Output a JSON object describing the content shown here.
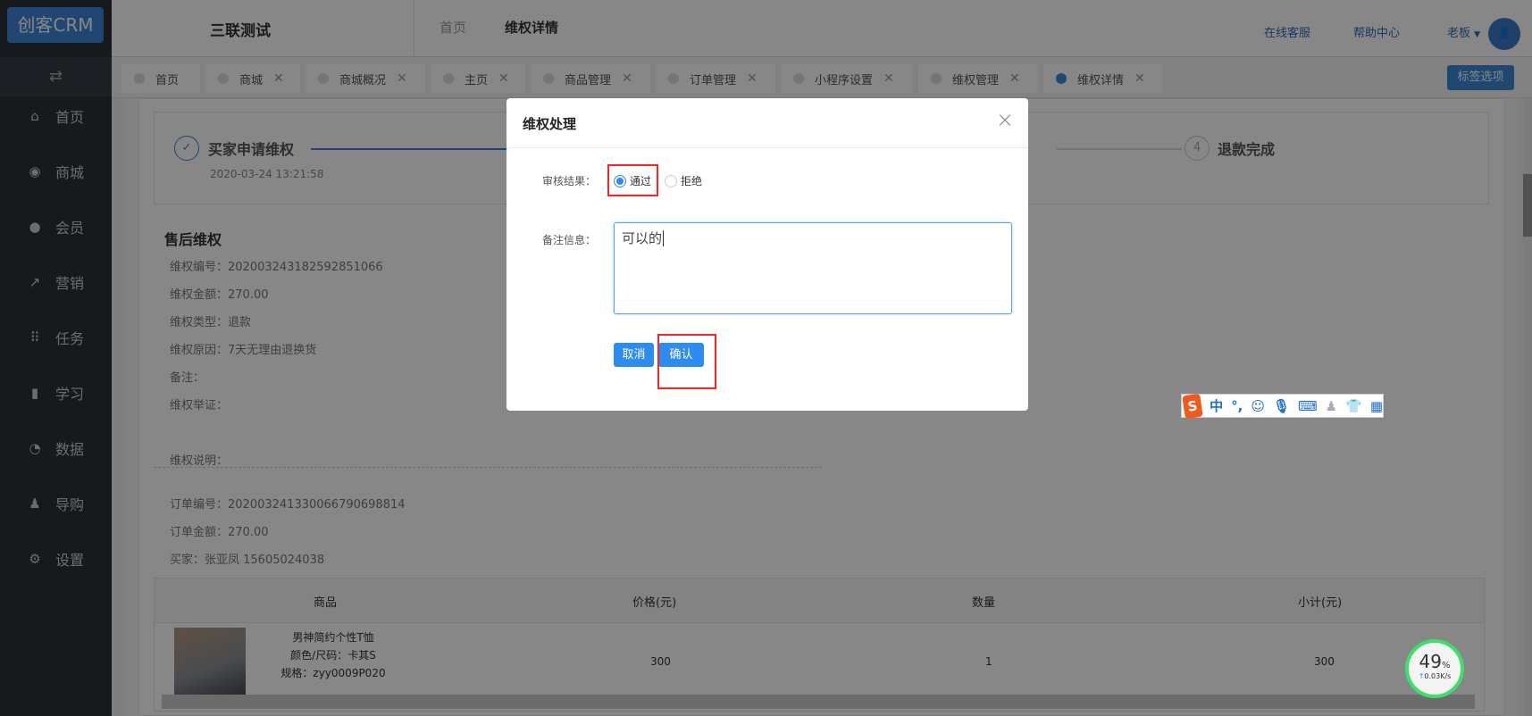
{
  "app": {
    "logo": "创客CRM",
    "company": "三联测试",
    "breadcrumb": [
      "首页",
      "维权详情"
    ],
    "links": [
      "在线客服",
      "帮助中心"
    ],
    "user": "老板"
  },
  "sidebar": [
    {
      "icon": "home-icon",
      "g": "⌂",
      "label": "首页"
    },
    {
      "icon": "shop-icon",
      "g": "◉",
      "label": "商城"
    },
    {
      "icon": "member-icon",
      "g": "●",
      "label": "会员"
    },
    {
      "icon": "marketing-icon",
      "g": "↗",
      "label": "营销"
    },
    {
      "icon": "task-icon",
      "g": "⠿",
      "label": "任务"
    },
    {
      "icon": "book-icon",
      "g": "▮",
      "label": "学习"
    },
    {
      "icon": "chart-icon",
      "g": "◔",
      "label": "数据"
    },
    {
      "icon": "guide-icon",
      "g": "♟",
      "label": "导购"
    },
    {
      "icon": "gear-icon",
      "g": "⚙",
      "label": "设置"
    }
  ],
  "tabs": [
    {
      "label": "首页",
      "close": false
    },
    {
      "label": "商城",
      "close": true
    },
    {
      "label": "商城概况",
      "close": true
    },
    {
      "label": "主页",
      "close": true
    },
    {
      "label": "商品管理",
      "close": true
    },
    {
      "label": "订单管理",
      "close": true
    },
    {
      "label": "小程序设置",
      "close": true
    },
    {
      "label": "维权管理",
      "close": true
    },
    {
      "label": "维权详情",
      "close": true,
      "active": true
    }
  ],
  "tab_options": "标签选项",
  "steps": {
    "first": {
      "label": "买家申请维权",
      "time": "2020-03-24 13:21:58"
    },
    "last": {
      "num": "4",
      "label": "退款完成"
    }
  },
  "detail": {
    "title": "售后维权",
    "rows": [
      "维权编号：20200324318259285106​6",
      "维权金额：270.00",
      "维权类型：退款",
      "维权原因：7天无理由退换货",
      "备注：",
      "维权举证："
    ],
    "note_label": "维权说明：",
    "order": [
      "订单编号：20200324133006679069881​4",
      "订单金额：270.00",
      "买家：张亚凤  15605024038"
    ]
  },
  "table": {
    "headers": [
      "商品",
      "价格(元)",
      "数量",
      "小计(元)"
    ],
    "rows": [
      {
        "name": "男神简约个性T恤",
        "spec": "颜色/尺码：卡其S",
        "sku": "规格：zyy0009P020",
        "price": "300",
        "qty": "1",
        "subtotal": "300"
      }
    ]
  },
  "dialog": {
    "title": "维权处理",
    "result_label": "审核结果：",
    "options": [
      "通过",
      "拒绝"
    ],
    "selected": "通过",
    "remark_label": "备注信息：",
    "remark_value": "可以的",
    "cancel": "取消",
    "confirm": "确认"
  },
  "ime": {
    "items": [
      "中",
      "°,"
    ]
  },
  "netwidget": {
    "percent": "49",
    "unit": "%",
    "speed": "0.03K/s"
  },
  "colors": {
    "accent": "#2d8cf0",
    "highlight": "#ff2222"
  }
}
